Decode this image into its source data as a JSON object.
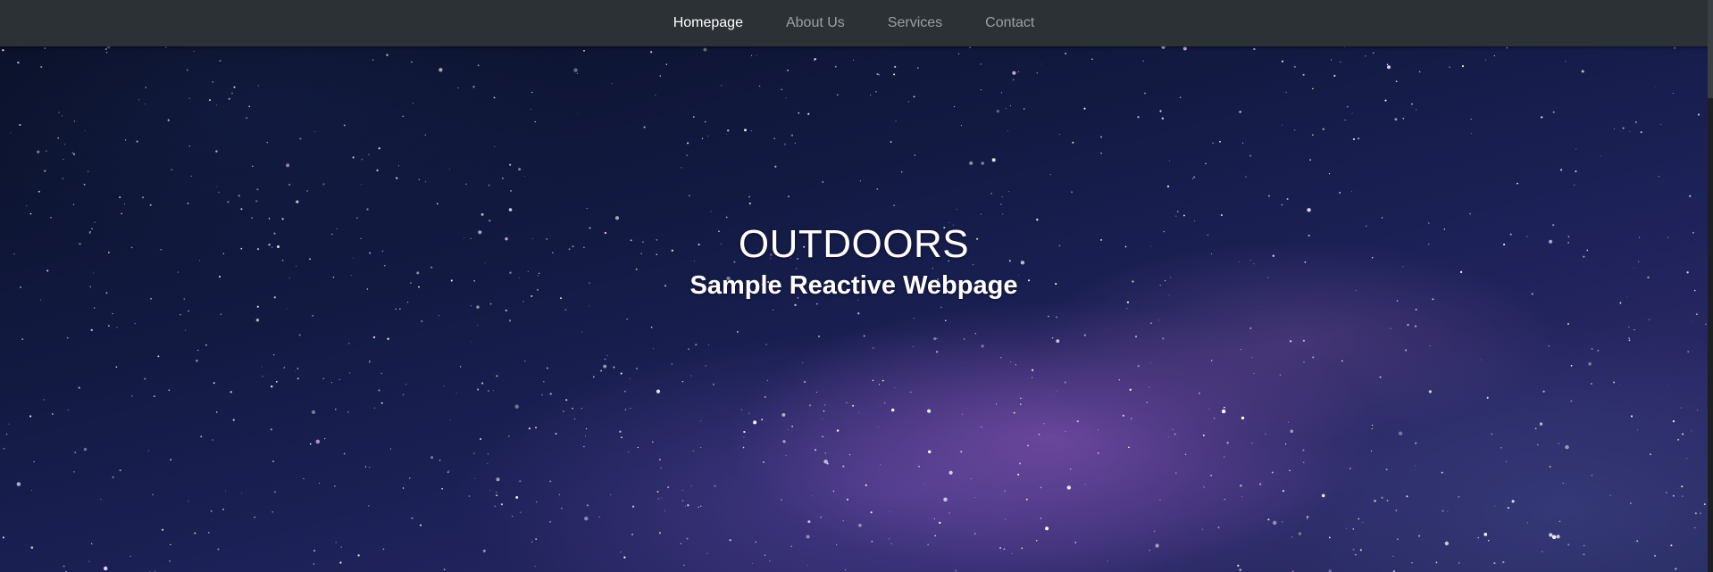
{
  "nav": {
    "items": [
      {
        "label": "Homepage",
        "active": true
      },
      {
        "label": "About Us",
        "active": false
      },
      {
        "label": "Services",
        "active": false
      },
      {
        "label": "Contact",
        "active": false
      }
    ]
  },
  "hero": {
    "title": "OUTDOORS",
    "subtitle": "Sample Reactive Webpage",
    "background": "starry-night-sky-image"
  },
  "colors": {
    "navbar_bg": "#2c3135",
    "nav_active": "#ffffff",
    "nav_inactive": "#9aa0a5",
    "hero_text": "#ffffff"
  }
}
